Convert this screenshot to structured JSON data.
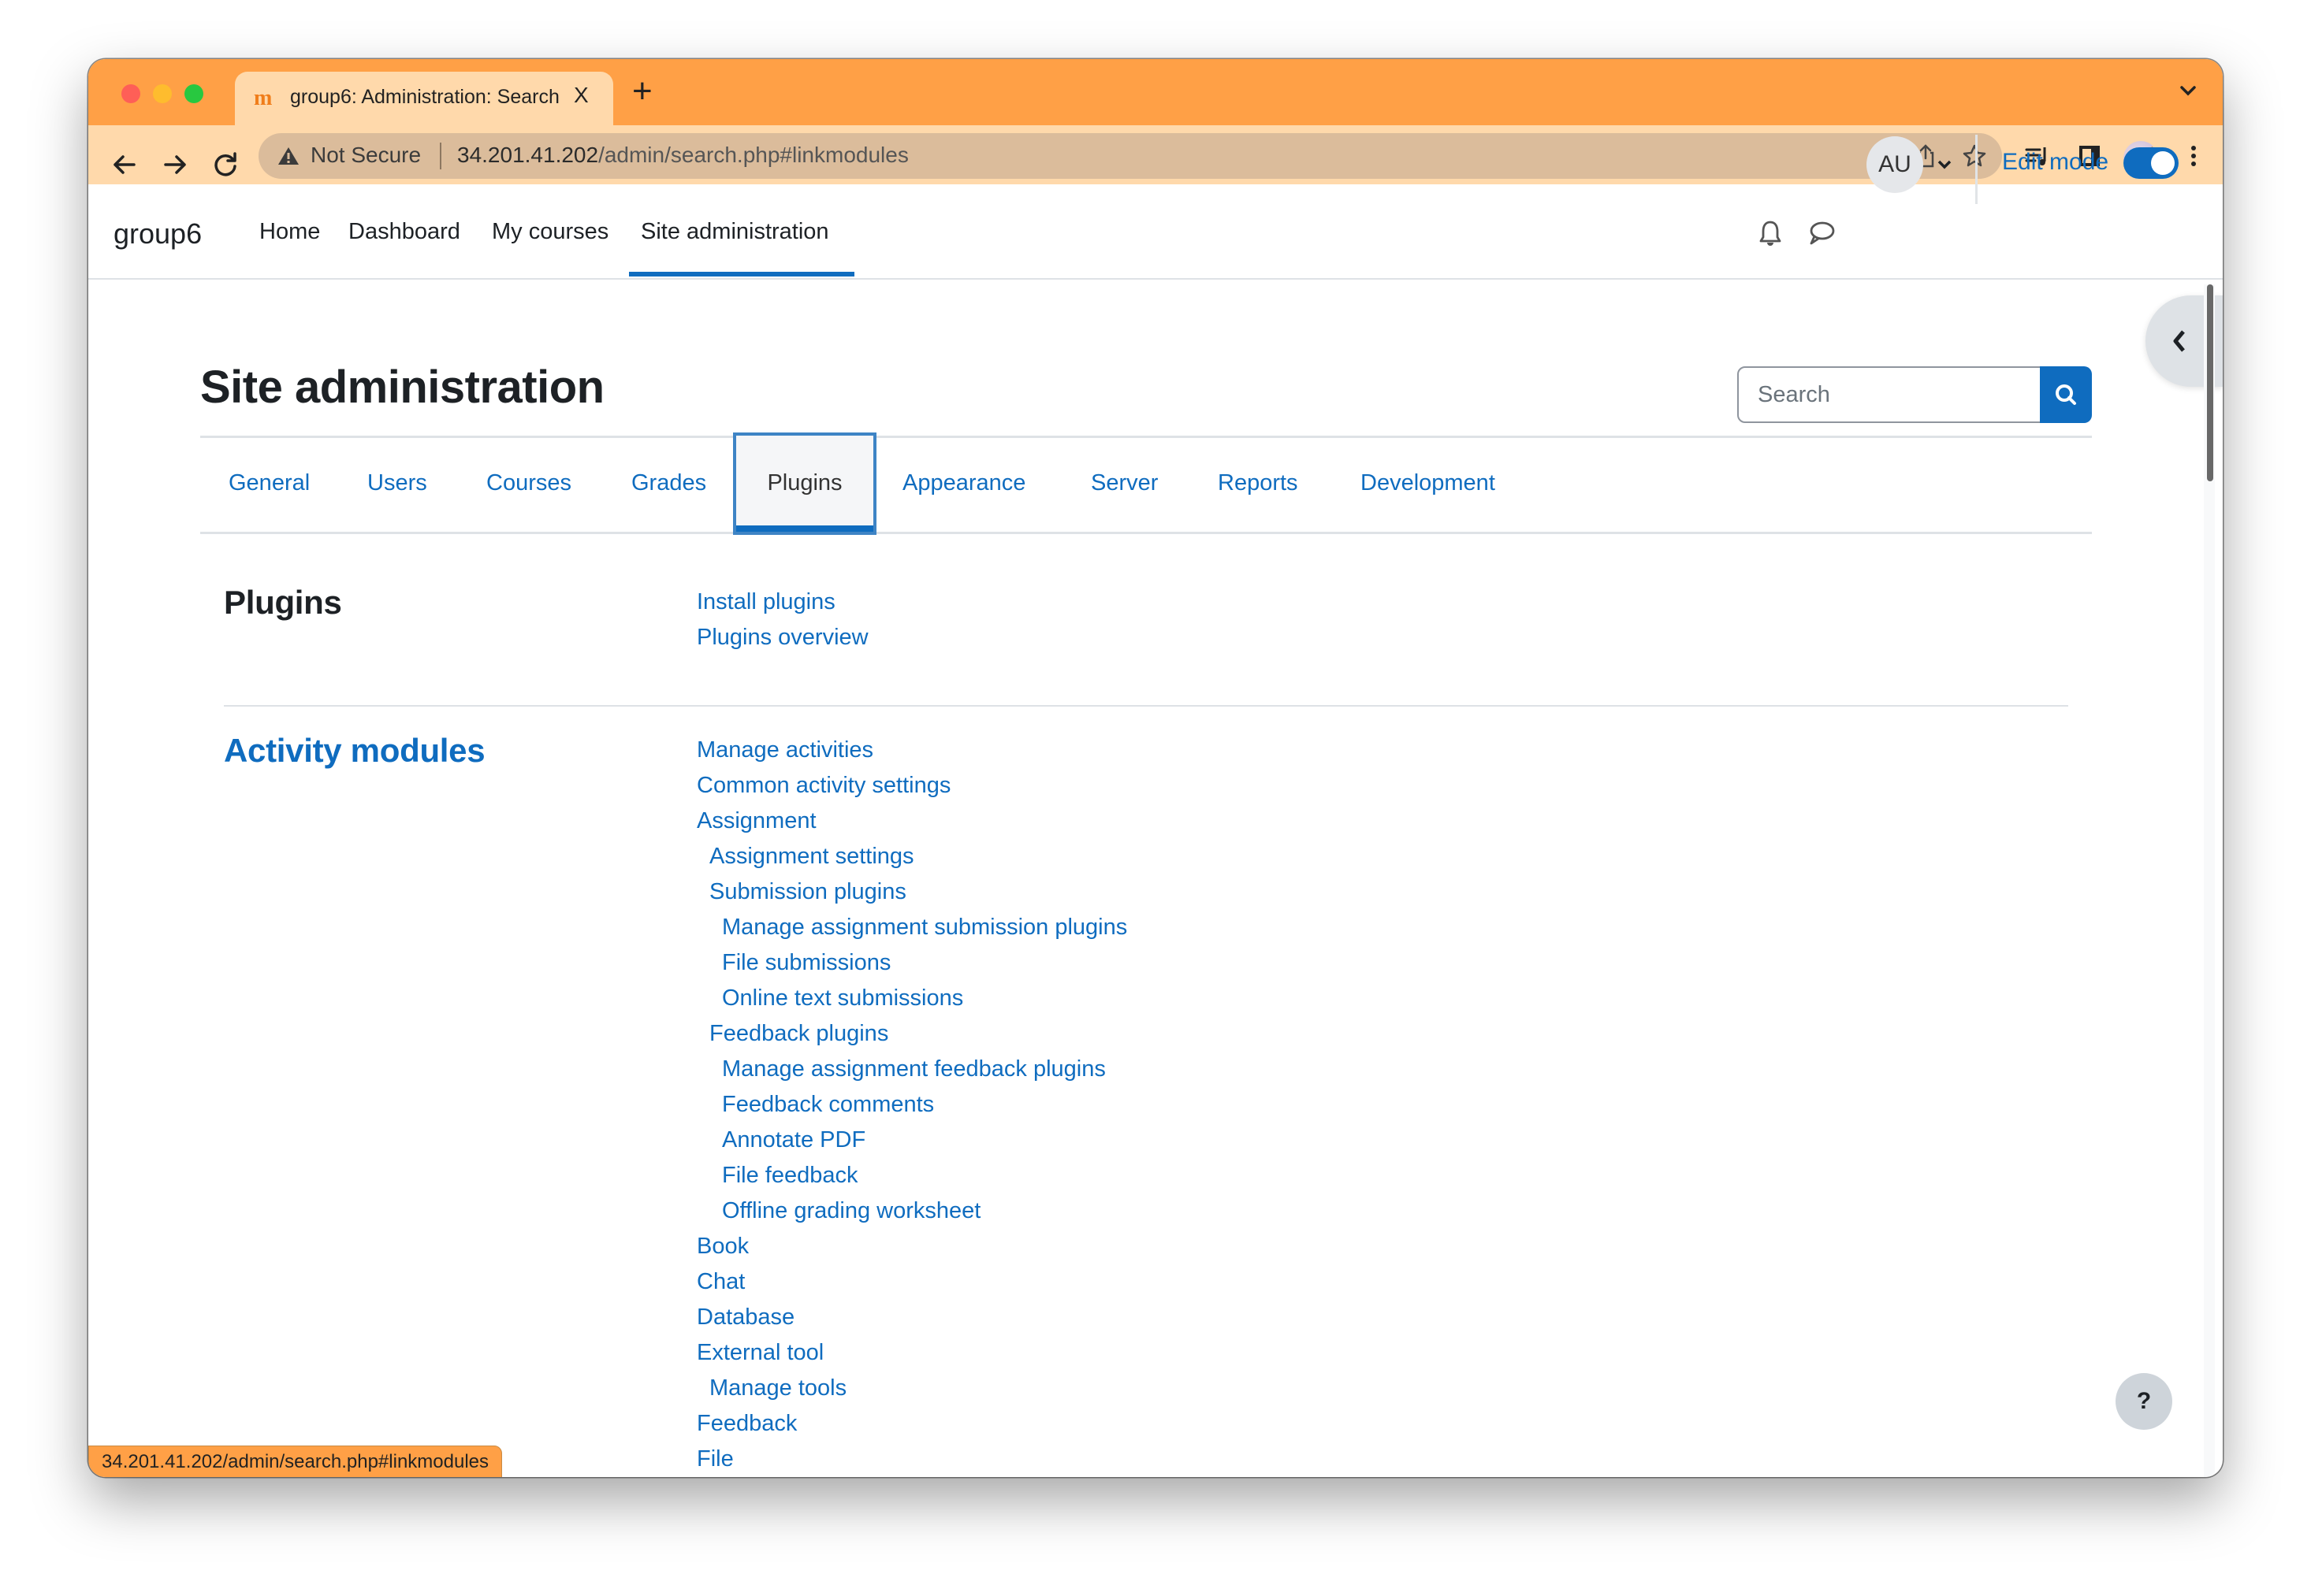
{
  "browser": {
    "tab_title": "group6: Administration: Search",
    "tab_close": "X",
    "new_tab": "+",
    "security_label": "Not Secure",
    "url_host": "34.201.41.202",
    "url_path": "/admin/search.php#linkmodules",
    "status_url": "34.201.41.202/admin/search.php#linkmodules",
    "accent_color": "#ffa046"
  },
  "header": {
    "brand": "group6",
    "primary_nav": [
      {
        "label": "Home"
      },
      {
        "label": "Dashboard"
      },
      {
        "label": "My courses"
      },
      {
        "label": "Site administration",
        "active": true
      }
    ],
    "avatar_initials": "AU",
    "edit_mode_label": "Edit mode",
    "edit_mode_on": true
  },
  "page": {
    "title": "Site administration",
    "search_placeholder": "Search",
    "tabs": [
      {
        "label": "General"
      },
      {
        "label": "Users"
      },
      {
        "label": "Courses"
      },
      {
        "label": "Grades"
      },
      {
        "label": "Plugins",
        "active": true
      },
      {
        "label": "Appearance"
      },
      {
        "label": "Server"
      },
      {
        "label": "Reports"
      },
      {
        "label": "Development"
      }
    ],
    "sections": [
      {
        "heading": "Plugins",
        "links": [
          {
            "label": "Install plugins",
            "level": 0
          },
          {
            "label": "Plugins overview",
            "level": 0
          }
        ]
      },
      {
        "heading": "Activity modules",
        "links": [
          {
            "label": "Manage activities",
            "level": 0
          },
          {
            "label": "Common activity settings",
            "level": 0
          },
          {
            "label": "Assignment",
            "level": 0
          },
          {
            "label": "Assignment settings",
            "level": 1
          },
          {
            "label": "Submission plugins",
            "level": 1
          },
          {
            "label": "Manage assignment submission plugins",
            "level": 2
          },
          {
            "label": "File submissions",
            "level": 2
          },
          {
            "label": "Online text submissions",
            "level": 2
          },
          {
            "label": "Feedback plugins",
            "level": 1
          },
          {
            "label": "Manage assignment feedback plugins",
            "level": 2
          },
          {
            "label": "Feedback comments",
            "level": 2
          },
          {
            "label": "Annotate PDF",
            "level": 2
          },
          {
            "label": "File feedback",
            "level": 2
          },
          {
            "label": "Offline grading worksheet",
            "level": 2
          },
          {
            "label": "Book",
            "level": 0
          },
          {
            "label": "Chat",
            "level": 0
          },
          {
            "label": "Database",
            "level": 0
          },
          {
            "label": "External tool",
            "level": 0
          },
          {
            "label": "Manage tools",
            "level": 1
          },
          {
            "label": "Feedback",
            "level": 0
          },
          {
            "label": "File",
            "level": 0
          }
        ]
      }
    ],
    "help_label": "?",
    "link_color": "#0f6cbf"
  }
}
